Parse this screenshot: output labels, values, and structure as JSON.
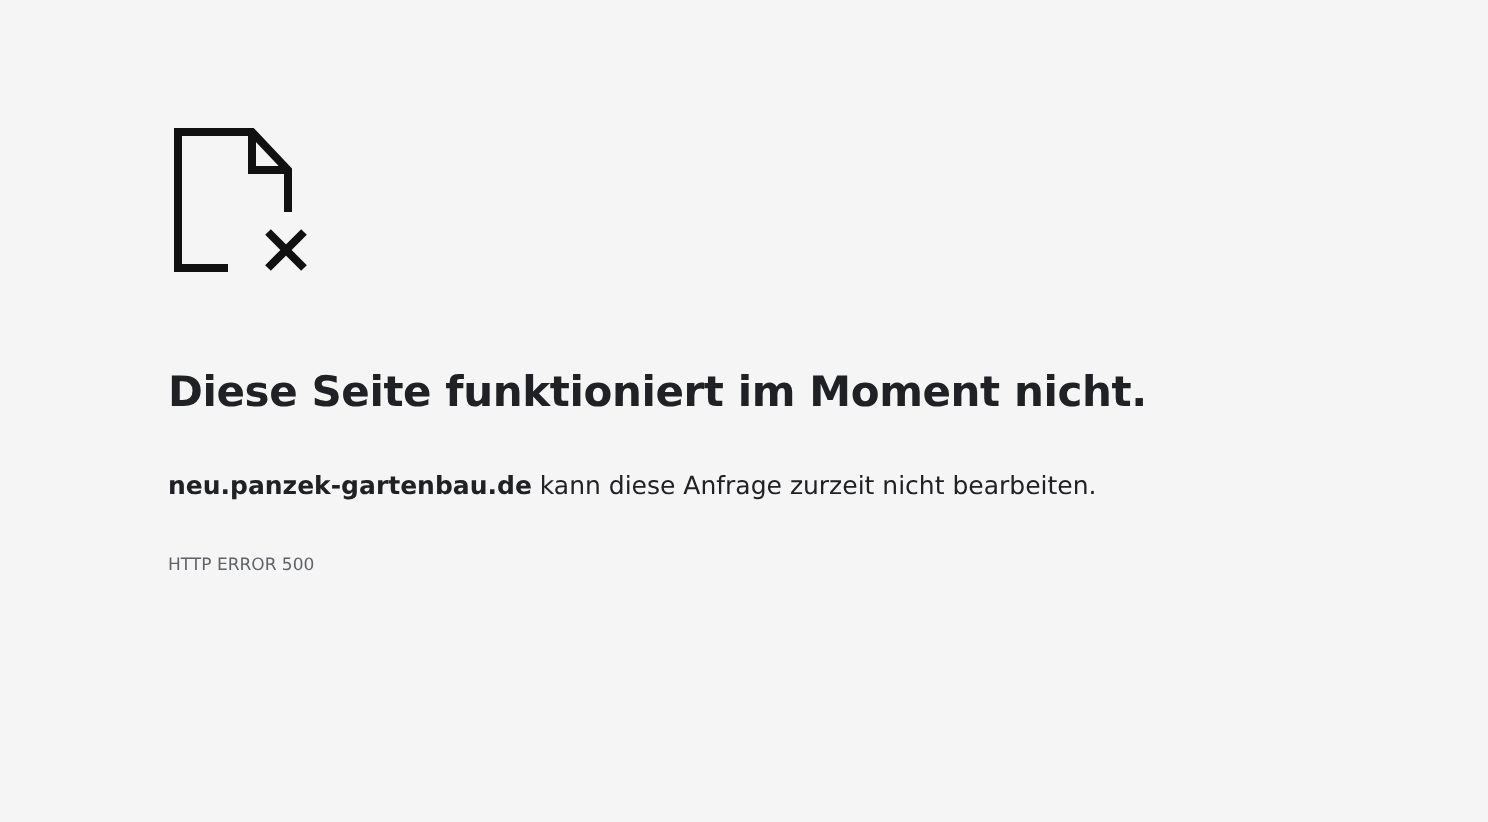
{
  "heading": "Diese Seite funktioniert im Moment nicht.",
  "message": "**neu.panzek-gartenbau.de** kann diese Anfrage zurzeit nicht bearbeiten.",
  "error_code": "HTTP ERROR 500"
}
